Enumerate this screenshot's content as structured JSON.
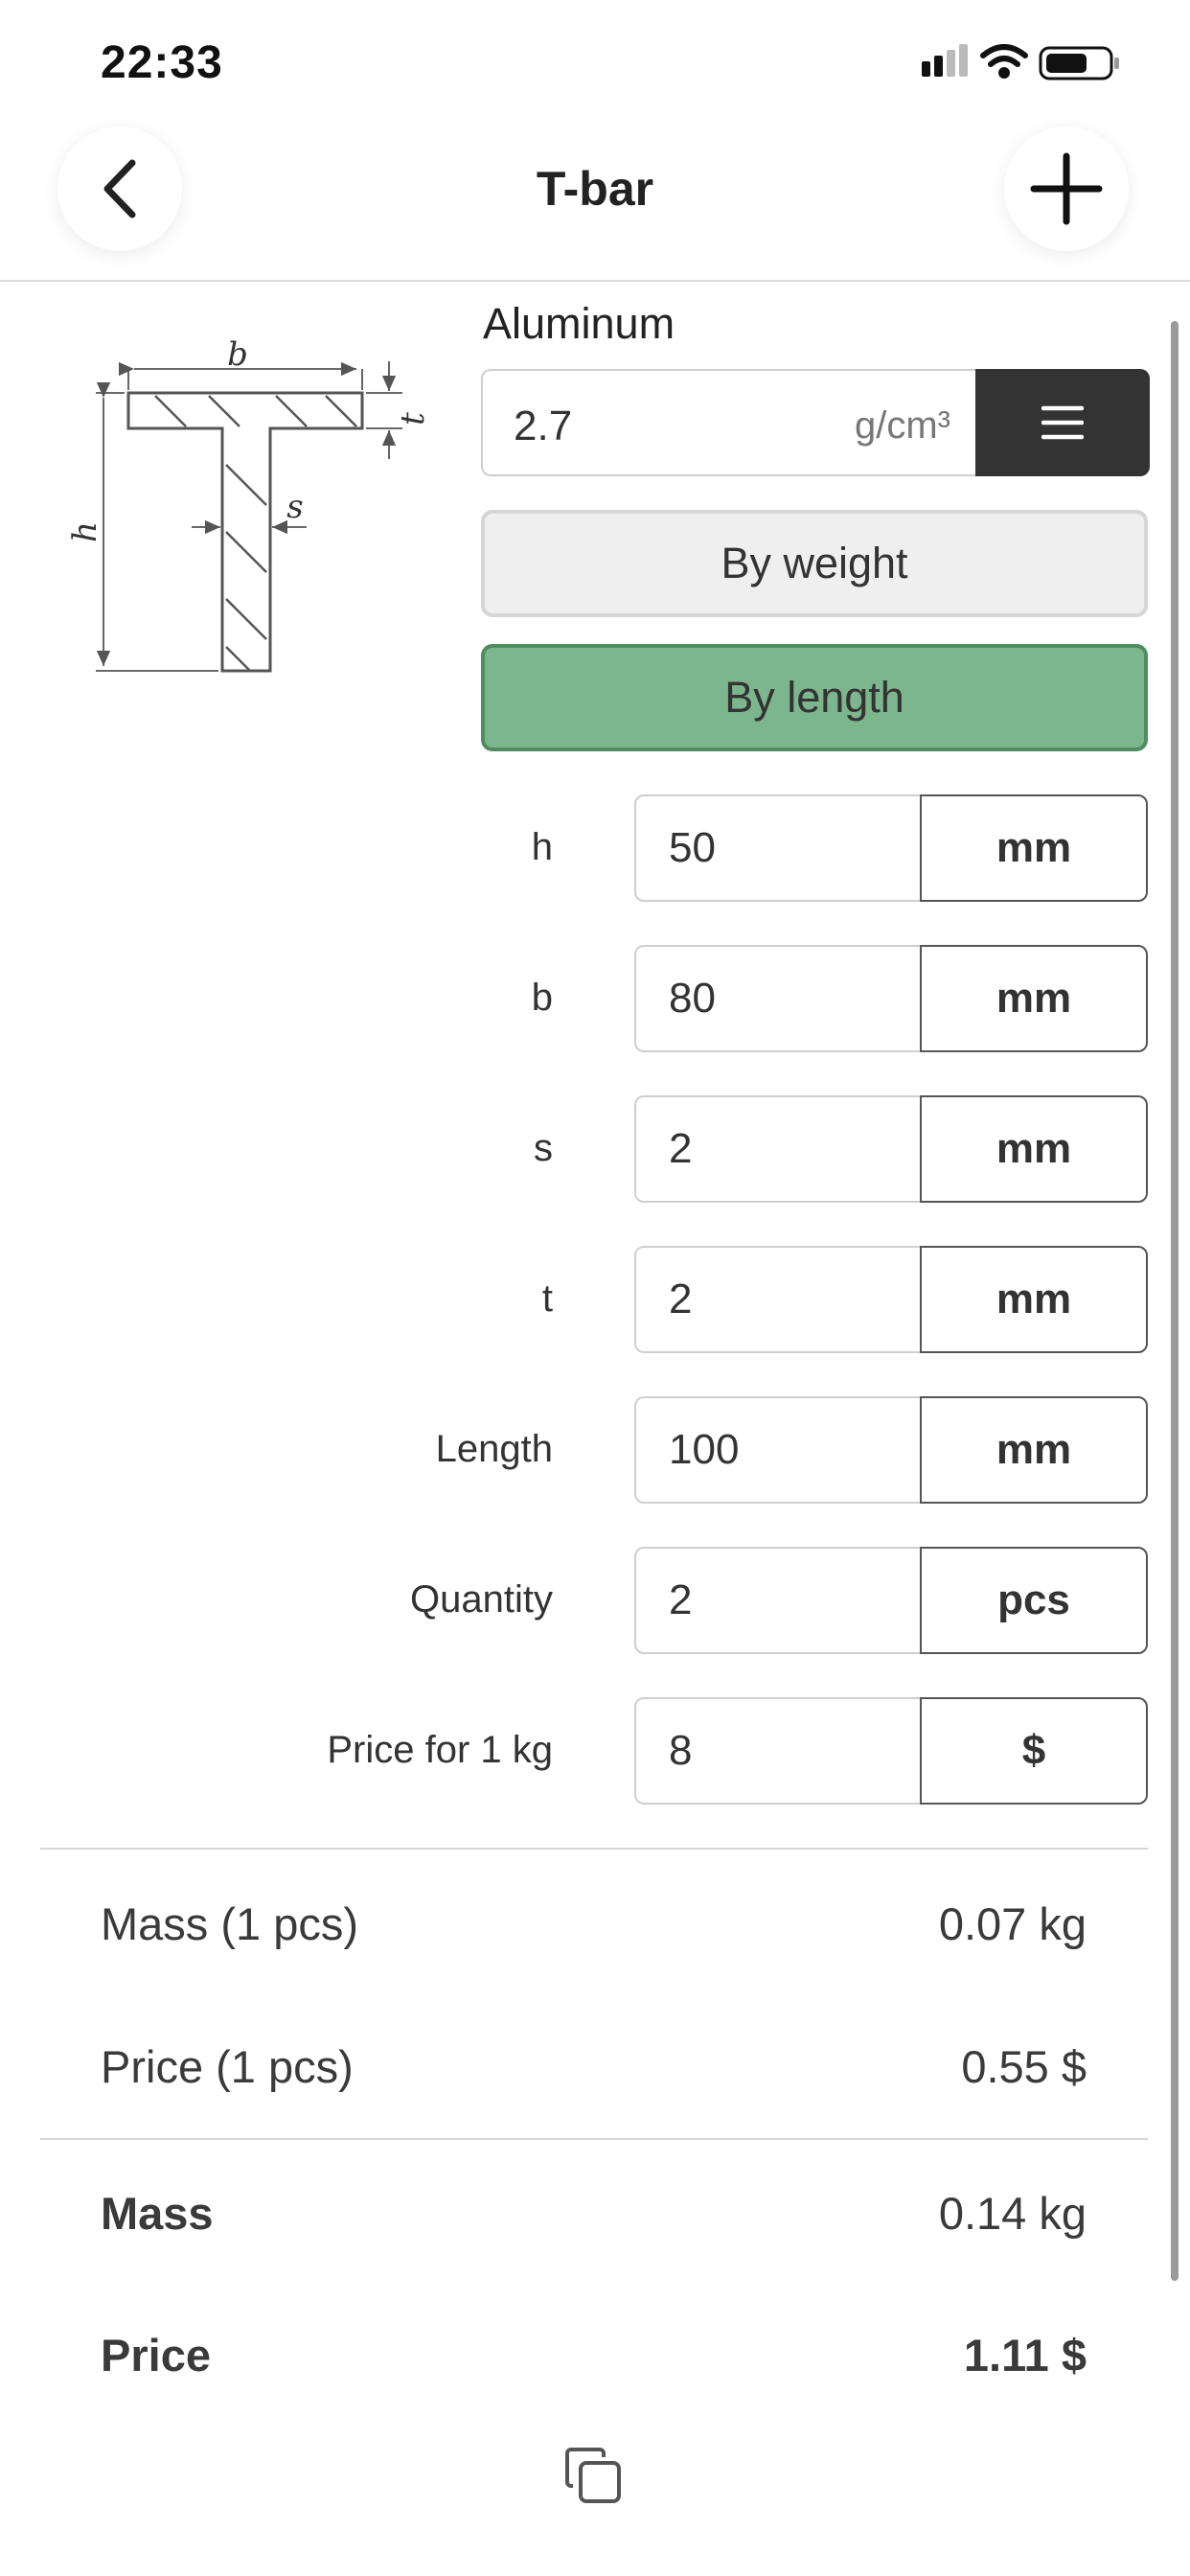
{
  "status_bar": {
    "time": "22:33",
    "icons": [
      "signal-icon",
      "wifi-icon",
      "battery-icon"
    ]
  },
  "nav": {
    "title": "T-bar",
    "back_icon": "chevron-left-icon",
    "add_icon": "plus-icon"
  },
  "diagram": {
    "labels": {
      "b": "b",
      "t": "t",
      "s": "s",
      "h": "h"
    }
  },
  "material": {
    "name": "Aluminum",
    "density_value": "2.7",
    "density_unit": "g/cm³",
    "menu_icon": "menu-icon"
  },
  "modes": {
    "by_weight": "By weight",
    "by_length": "By length",
    "selected": "By length"
  },
  "params": [
    {
      "label": "h",
      "value": "50",
      "unit": "mm"
    },
    {
      "label": "b",
      "value": "80",
      "unit": "mm"
    },
    {
      "label": "s",
      "value": "2",
      "unit": "mm"
    },
    {
      "label": "t",
      "value": "2",
      "unit": "mm"
    },
    {
      "label": "Length",
      "value": "100",
      "unit": "mm"
    },
    {
      "label": "Quantity",
      "value": "2",
      "unit": "pcs"
    },
    {
      "label": "Price for 1 kg",
      "value": "8",
      "unit": "$"
    }
  ],
  "results": {
    "mass_one_label": "Mass (1 pcs)",
    "mass_one_value": "0.07 kg",
    "price_one_label": "Price (1 pcs)",
    "price_one_value": "0.55 $",
    "mass_total_label": "Mass",
    "mass_total_value": "0.14 kg",
    "price_total_label": "Price",
    "price_total_value": "1.11 $"
  },
  "footer": {
    "copy_icon": "copy-icon"
  },
  "colors": {
    "accent_green": "#7cb68c",
    "accent_green_border": "#4c8e5e",
    "dark_button": "#333333"
  }
}
